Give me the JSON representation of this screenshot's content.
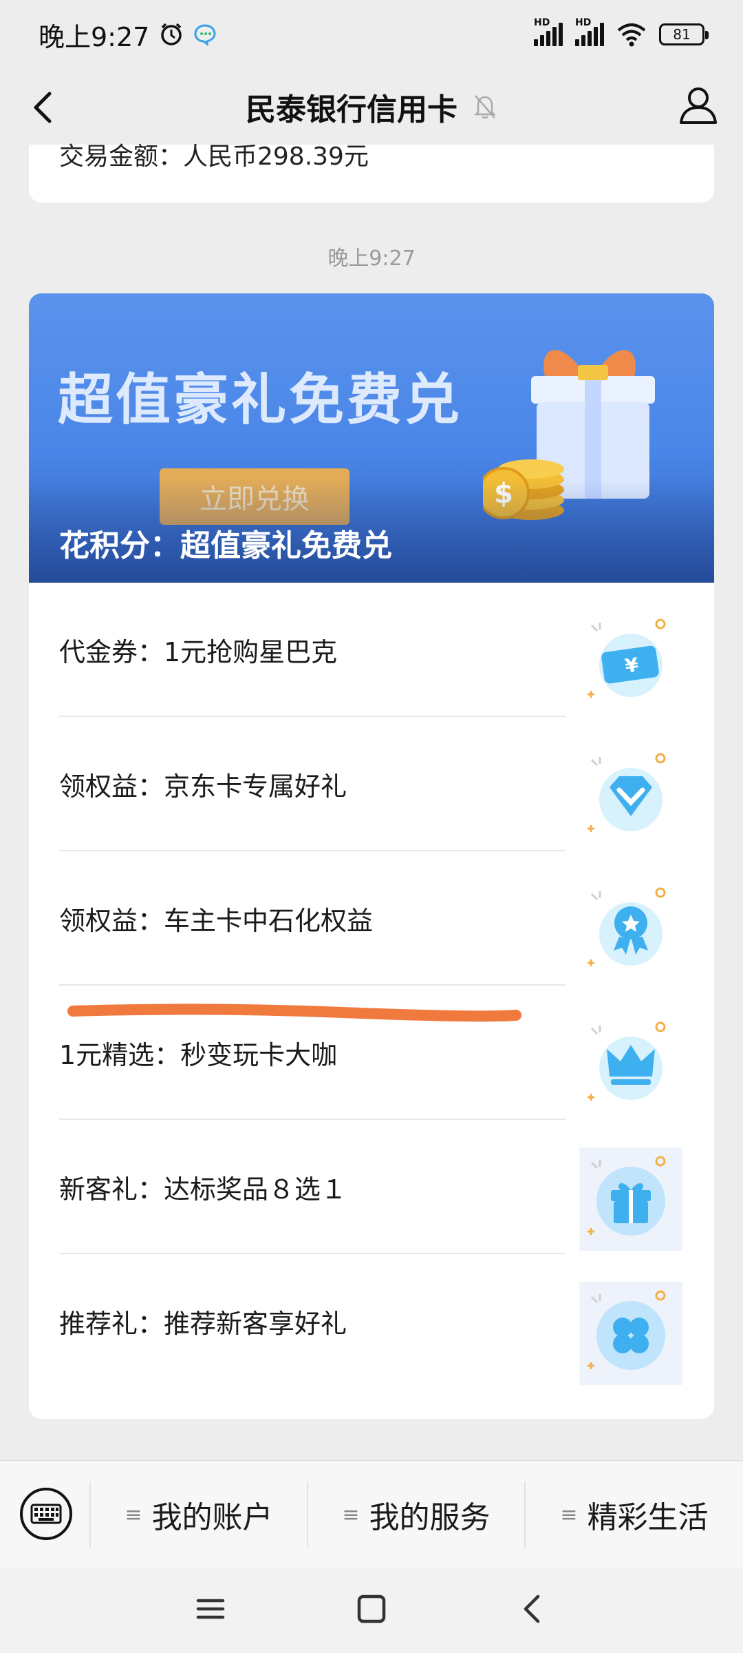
{
  "status_bar": {
    "time": "晚上9:27",
    "sim1": "HD",
    "sim2": "HD",
    "battery": "81"
  },
  "header": {
    "title": "民泰银行信用卡"
  },
  "previous_message": {
    "text": "交易金额：人民币298.39元"
  },
  "timestamp": "晚上9:27",
  "banner": {
    "headline": "超值豪礼免费兑",
    "button_label": "立即兑换",
    "caption": "花积分：超值豪礼免费兑"
  },
  "menu_items": [
    {
      "label": "代金券：1元抢购星巴克",
      "icon": "coupon-icon"
    },
    {
      "label": "领权益：京东卡专属好礼",
      "icon": "diamond-icon"
    },
    {
      "label": "领权益：车主卡中石化权益",
      "icon": "medal-icon"
    },
    {
      "label": "1元精选：秒变玩卡大咖",
      "icon": "crown-icon"
    },
    {
      "label": "新客礼：达标奖品８选１",
      "icon": "gift-icon"
    },
    {
      "label": "推荐礼：推荐新客享好礼",
      "icon": "clover-icon"
    }
  ],
  "bottom_menu": {
    "tabs": [
      "我的账户",
      "我的服务",
      "精彩生活"
    ]
  },
  "colors": {
    "banner_blue": "#4a86e8",
    "button_orange": "#f3b04a",
    "highlight_orange": "#f07a3e",
    "icon_blue": "#39b2f0"
  }
}
